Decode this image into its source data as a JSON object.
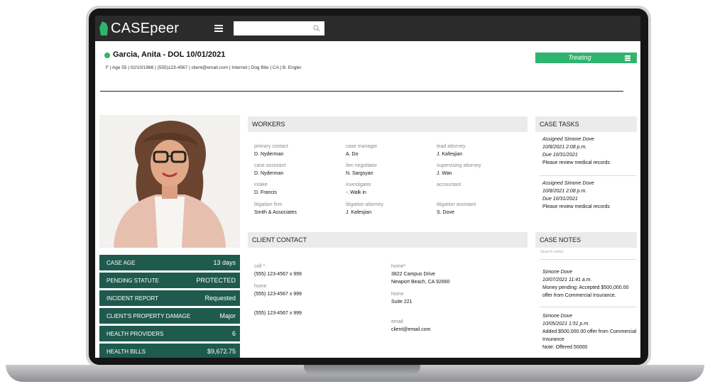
{
  "app": {
    "name": "CASEpeer",
    "search_placeholder": ""
  },
  "header": {
    "client_name": "Garcia, Anita - DOL 10/01/2021",
    "meta": "F | Age 55 | 02/10/1966 | (555)123-4567 | client@email.com | Internet | Dog Bite | CA | B. Engler",
    "status": "Treating"
  },
  "stats": [
    {
      "label": "CASE AGE",
      "value": "13 days"
    },
    {
      "label": "PENDING STATUTE",
      "value": "PROTECTED"
    },
    {
      "label": "INCIDENT REPORT",
      "value": "Requested"
    },
    {
      "label": "CLIENT'S PROPERTY DAMAGE",
      "value": "Major"
    },
    {
      "label": "HEALTH PROVIDERS",
      "value": "6"
    },
    {
      "label": "HEALTH BILLS",
      "value": "$9,672.75"
    }
  ],
  "workers": {
    "title": "WORKERS",
    "items": [
      {
        "label": "primary contact",
        "value": "D. Nyderman"
      },
      {
        "label": "case manager",
        "value": "A. Do"
      },
      {
        "label": "lead attorney",
        "value": "J. Kafesjian"
      },
      {
        "label": "case assistant",
        "value": "D. Nyderman"
      },
      {
        "label": "lien negotiator",
        "value": "N. Sargsyan"
      },
      {
        "label": "supervising attorney",
        "value": "J. Wan"
      },
      {
        "label": "intake",
        "value": "D. Francis"
      },
      {
        "label": "investigator",
        "value": "-. Walk in"
      },
      {
        "label": "accountant",
        "value": ""
      },
      {
        "label": "litigation firm",
        "value": "Smith & Associates"
      },
      {
        "label": "litigation attorney",
        "value": "J. Kafesjian"
      },
      {
        "label": "litigation assistant",
        "value": "S. Dove"
      }
    ]
  },
  "client_contact": {
    "title": "CLIENT CONTACT",
    "cell_label": "cell *",
    "cell_value": "(555) 123-4567 x 999",
    "home_label": "home",
    "home_value": "(555) 123-4567 x 999",
    "other_value": "(555) 123-4567 x 999",
    "home_addr_label": "home*",
    "home_addr_line1": "3822 Campus Drive",
    "home_addr_line2": "Newport Beach, CA 92660",
    "home2_label": "home",
    "home2_value": "Suite 221",
    "email_label": "email",
    "email_value": "client@email.com"
  },
  "case_tasks": {
    "title": "CASE TASKS",
    "items": [
      {
        "assigned": "Assigned Simone Dove",
        "date": "10/8/2021 2:08 p.m.",
        "due": "Due 10/31/2021",
        "text": "Please review medical records"
      },
      {
        "assigned": "Assigned Simone Dove",
        "date": "10/8/2021 2:08 p.m.",
        "due": "Due 10/31/2021",
        "text": "Please review medical records"
      }
    ]
  },
  "case_notes": {
    "title": "CASE NOTES",
    "search_placeholder": "Search notes",
    "items": [
      {
        "author": "Simone Dove",
        "date": "10/07/2021 11:41 a.m.",
        "line1": "Money pending: Accepted $500,000.00",
        "line2": "offer from Commercial Insurance.",
        "line3": ""
      },
      {
        "author": "Simone Dove",
        "date": "10/05/2021 1:51 p.m.",
        "line1": "Added $500,000.00 offer from Commercial",
        "line2": "Insurance",
        "line3": "Note: Offered 50000"
      }
    ]
  },
  "colors": {
    "brand_green": "#2fb46e",
    "stat_bg": "#1f5a4e",
    "topbar": "#2b2b2b"
  },
  "icons": [
    "logo-mark-icon",
    "hamburger-icon",
    "search-icon",
    "status-dot-icon",
    "menu-icon"
  ]
}
